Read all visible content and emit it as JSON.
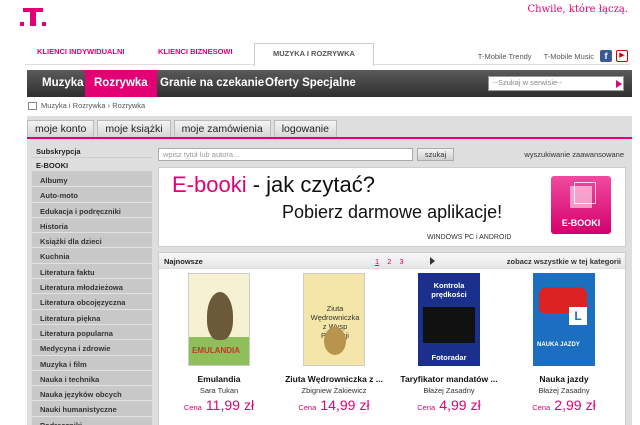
{
  "header": {
    "tagline": "Chwile, które łączą."
  },
  "segments": [
    {
      "label": "KLIENCI INDYWIDUALNI"
    },
    {
      "label": "KLIENCI BIZNESOWI"
    },
    {
      "label": "MUZYKA I ROZRYWKA"
    }
  ],
  "toplinks": {
    "trendy": "T-Mobile Trendy",
    "music": "T-Mobile Music",
    "facebook_icon": "f",
    "youtube_icon": "▶"
  },
  "mainnav": {
    "items": [
      {
        "label": "Muzyka"
      },
      {
        "label": "Rozrywka"
      },
      {
        "label": "Granie na czekanie"
      },
      {
        "label": "Oferty Specjalne"
      }
    ],
    "active_color": "#e20074",
    "search_placeholder": "--Szukaj w serwisie--"
  },
  "breadcrumb": "Muzyka i Rozrywka › Rozrywka",
  "account_tabs": [
    {
      "label": "moje konto"
    },
    {
      "label": "moje książki"
    },
    {
      "label": "moje zamówienia"
    },
    {
      "label": "logowanie"
    }
  ],
  "sidebar": {
    "headings": [
      "Subskrypcja",
      "E-BOOKI"
    ],
    "items": [
      "Albumy",
      "Auto-moto",
      "Edukacja i podręczniki",
      "Historia",
      "Książki dla dzieci",
      "Kuchnia",
      "Literatura faktu",
      "Literatura młodzieżowa",
      "Literatura obcojęzyczna",
      "Literatura piękna",
      "Literatura popularna",
      "Medycyna i zdrowie",
      "Muzyka i film",
      "Nauka i technika",
      "Nauka języków obcych",
      "Nauki humanistyczne",
      "Podręczniki"
    ]
  },
  "search_bar": {
    "placeholder": "wpisz tytuł lub autora...",
    "button": "szukaj",
    "advanced": "wyszukiwanie zaawansowane"
  },
  "banner": {
    "title_pink": "E-booki",
    "title_rest": " - jak czytać?",
    "subtitle": "Pobierz darmowe aplikacje!",
    "platforms": "WINDOWS PC i ANDROID",
    "badge_label": "E-BOOKI"
  },
  "newest": {
    "title": "Najnowsze",
    "pages": [
      "1",
      "2",
      "3"
    ],
    "see_all": "zobacz wszystkie w tej kategorii",
    "price_label": "Cena",
    "currency": "zł",
    "books": [
      {
        "title": "Emulandia",
        "author": "Sara Tukan",
        "price": "11,99",
        "cover_text": "EMULANDIA",
        "cover_author": "Sara Tukan"
      },
      {
        "title": "Ziuta Wędrowniczka z ...",
        "author": "Zbigniew Żakiewicz",
        "price": "14,99",
        "cover_text": "Ziuta Wędrowniczka z Wysp Polinezji",
        "cover_author": "Zbigniew Żakiewicz"
      },
      {
        "title": "Taryfikator mandatów ...",
        "author": "Błażej Zasadny",
        "price": "4,99",
        "cover_text": "Kontrola prędkości",
        "cover_text2": "Fotoradar"
      },
      {
        "title": "Nauka jazdy",
        "author": "Błażej Zasadny",
        "price": "2,99",
        "cover_text": "NAUKA JAZDY",
        "cover_letter": "L"
      }
    ]
  }
}
